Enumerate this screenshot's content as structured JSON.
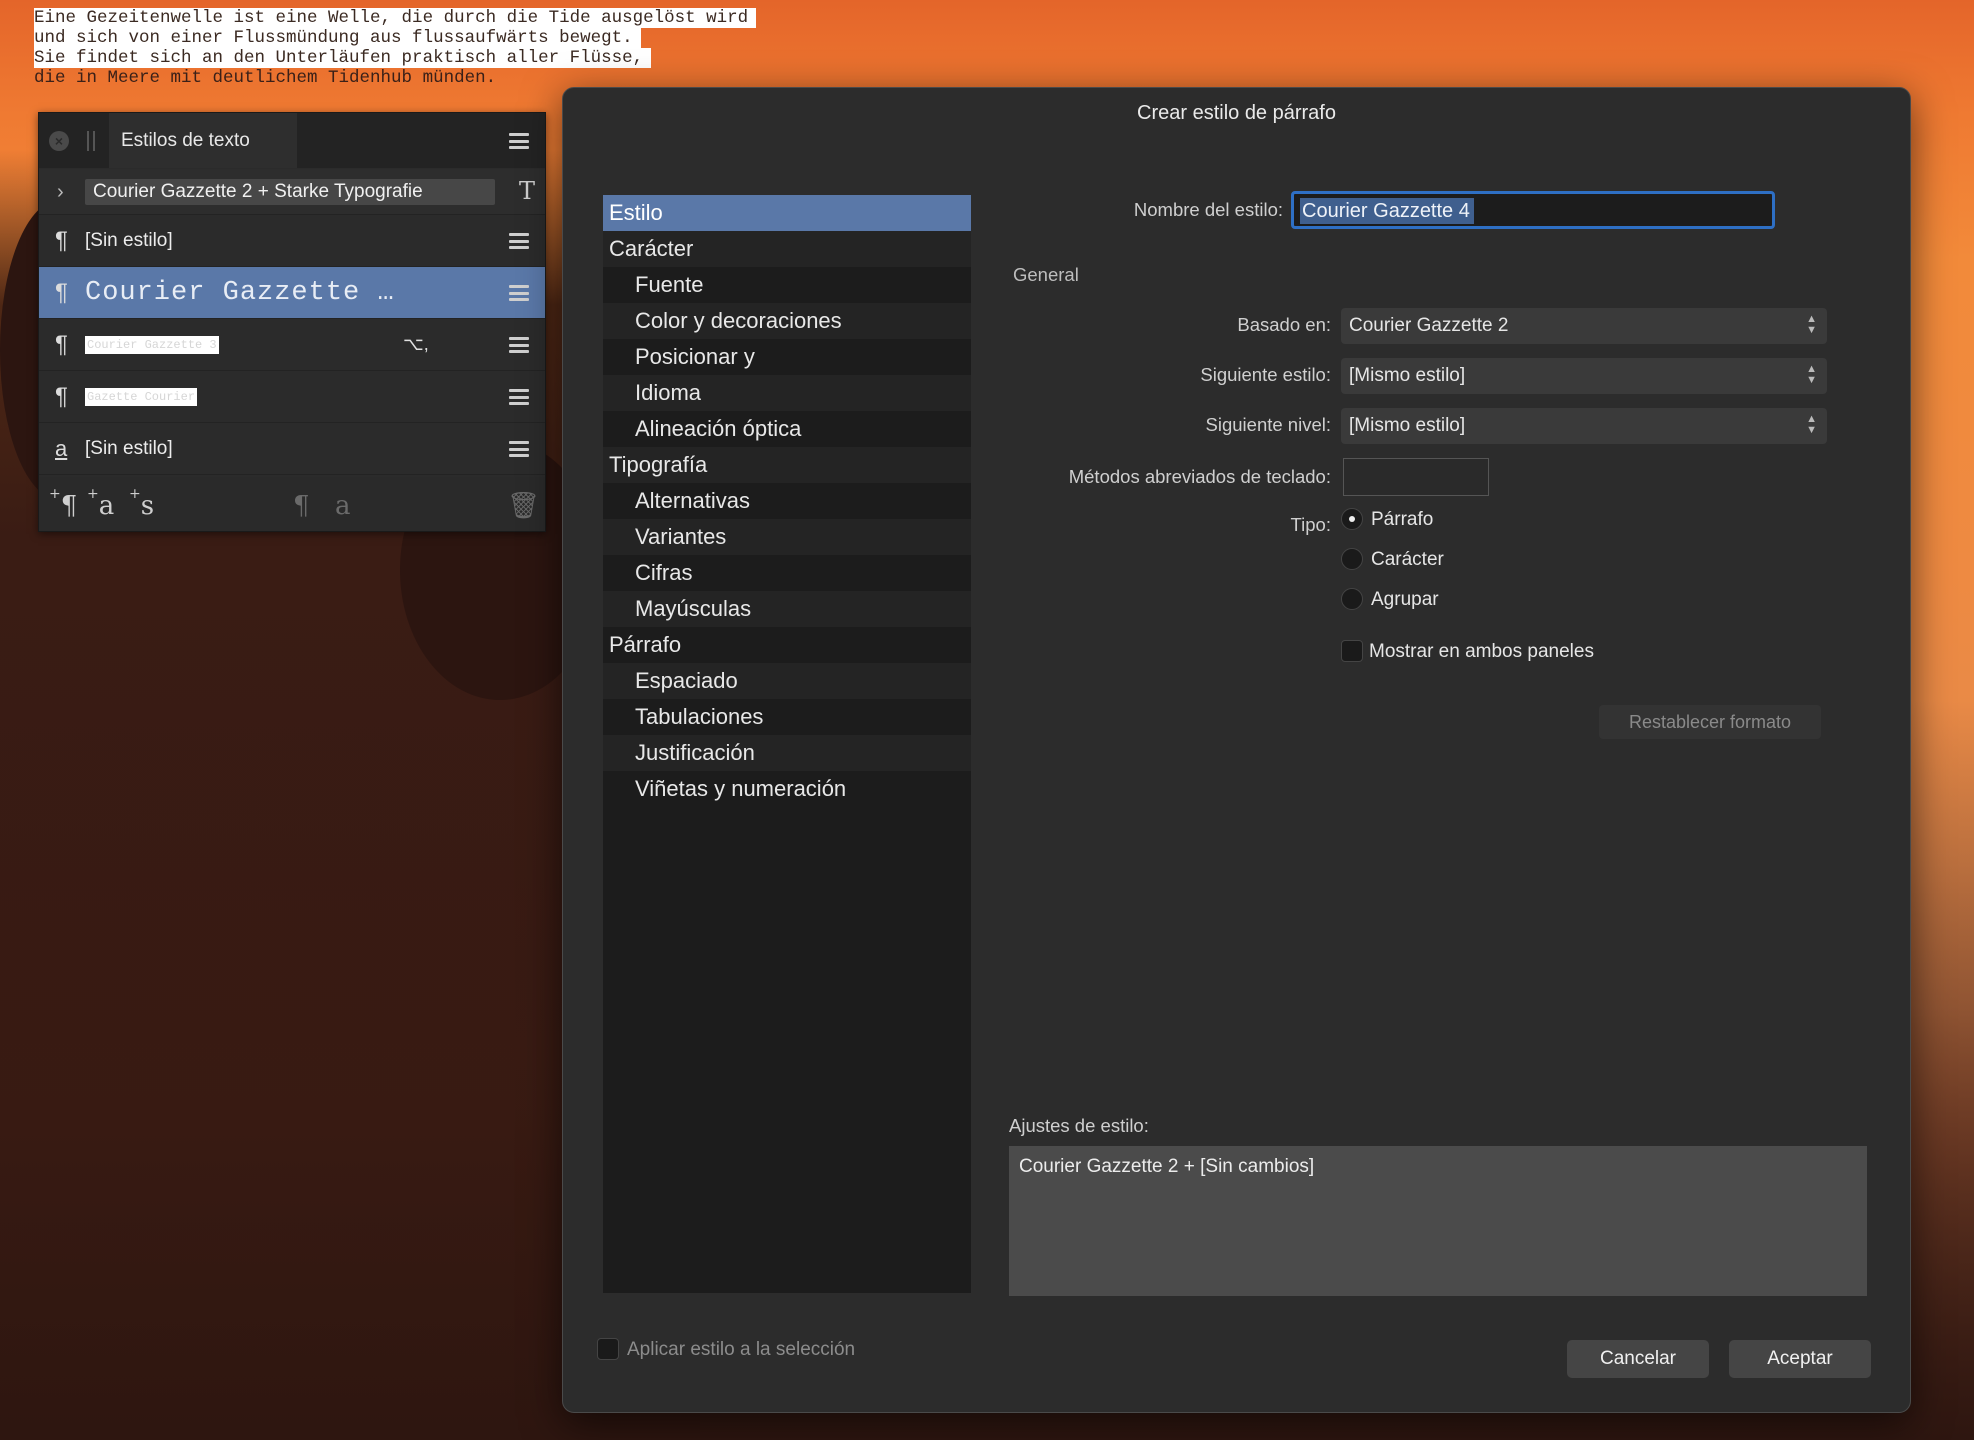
{
  "document": {
    "lines": [
      "Eine Gezeitenwelle ist eine Welle, die durch die Tide ausgelöst wird",
      "und sich von einer Flussmündung aus flussaufwärts bewegt.",
      "Sie findet sich an den Unterläufen praktisch aller Flüsse,",
      "die in Meere mit deutlichem Tidenhub münden."
    ]
  },
  "text_styles_panel": {
    "tab_label": "Estilos de texto",
    "group_label": "Courier Gazzette 2 + Starke Typografie",
    "rows": [
      {
        "label": "[Sin estilo]",
        "type": "paragraph"
      },
      {
        "label": "Courier Gazzette …",
        "type": "paragraph",
        "selected": true
      },
      {
        "label": "Courier Gazzette 3",
        "type": "paragraph",
        "swatch": true,
        "shortcut": "⌥,"
      },
      {
        "label": "Gazette Courier",
        "type": "paragraph",
        "swatch": true
      },
      {
        "label": "[Sin estilo]",
        "type": "character"
      }
    ]
  },
  "dialog": {
    "title": "Crear estilo de párrafo",
    "categories": [
      {
        "label": "Estilo",
        "level": 0,
        "active": true
      },
      {
        "label": "Carácter",
        "level": 0
      },
      {
        "label": "Fuente",
        "level": 1
      },
      {
        "label": "Color y decoraciones",
        "level": 1
      },
      {
        "label": "Posicionar y",
        "level": 1
      },
      {
        "label": "Idioma",
        "level": 1
      },
      {
        "label": "Alineación óptica",
        "level": 1
      },
      {
        "label": "Tipografía",
        "level": 0
      },
      {
        "label": "Alternativas",
        "level": 1
      },
      {
        "label": "Variantes",
        "level": 1
      },
      {
        "label": "Cifras",
        "level": 1
      },
      {
        "label": "Mayúsculas",
        "level": 1
      },
      {
        "label": "Párrafo",
        "level": 0
      },
      {
        "label": "Espaciado",
        "level": 1
      },
      {
        "label": "Tabulaciones",
        "level": 1
      },
      {
        "label": "Justificación",
        "level": 1
      },
      {
        "label": "Viñetas y numeración",
        "level": 1
      }
    ],
    "style_name_label": "Nombre del estilo:",
    "style_name_value": "Courier Gazzette 4",
    "general_heading": "General",
    "based_on_label": "Basado en:",
    "based_on_value": "Courier Gazzette 2",
    "next_style_label": "Siguiente estilo:",
    "next_style_value": "[Mismo estilo]",
    "next_level_label": "Siguiente nivel:",
    "next_level_value": "[Mismo estilo]",
    "shortcuts_label": "Métodos abreviados de teclado:",
    "type_label": "Tipo:",
    "type_options": [
      "Párrafo",
      "Carácter",
      "Agrupar"
    ],
    "type_selected": "Párrafo",
    "show_both_panels_label": "Mostrar en ambos paneles",
    "reset_format_label": "Restablecer formato",
    "style_settings_label": "Ajustes de estilo:",
    "style_settings_value": "Courier Gazzette 2 + [Sin cambios]",
    "apply_to_selection_label": "Aplicar estilo a la selección",
    "cancel_label": "Cancelar",
    "accept_label": "Aceptar"
  },
  "colors": {
    "accent_selection": "#5a78a8",
    "focus_ring": "#2e6fc4",
    "dialog_bg": "#2c2c2c"
  }
}
